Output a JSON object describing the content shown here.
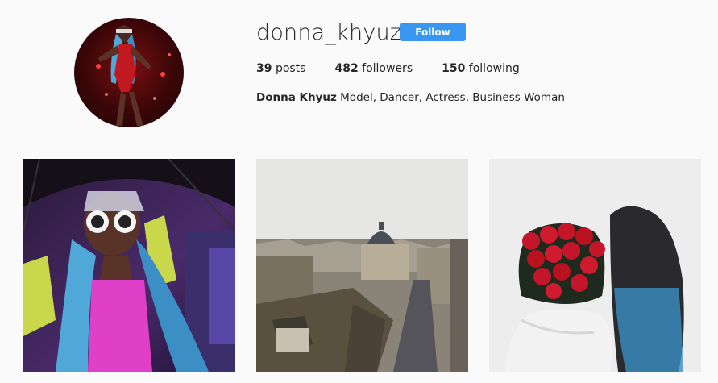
{
  "profile": {
    "username": "donna_khyuz",
    "follow_label": "Follow",
    "stats": {
      "posts_count": "39",
      "posts_label": "posts",
      "followers_count": "482",
      "followers_label": "followers",
      "following_count": "150",
      "following_label": "following"
    },
    "bio": {
      "full_name": "Donna Khyuz",
      "text": "Model, Dancer, Actress, Business Woman"
    }
  },
  "colors": {
    "background": "#fafafa",
    "follow_button": "#3897f0",
    "text": "#262626"
  },
  "icons": {
    "avatar": "profile-avatar",
    "photos": [
      "photo-dancer-umbrella",
      "photo-city-view",
      "photo-roses-bouquet"
    ]
  }
}
